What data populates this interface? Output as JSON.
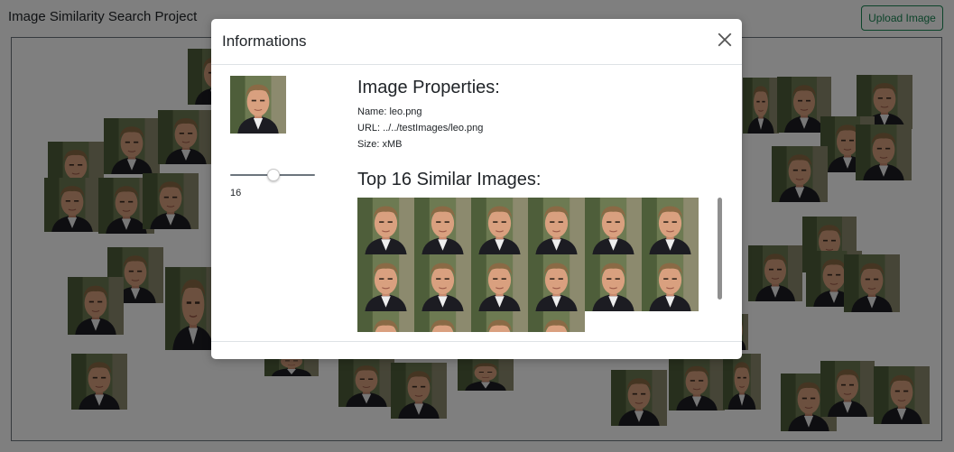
{
  "page": {
    "title": "Image Similarity Search Project",
    "upload_button": "Upload Image",
    "accent_color": "#198754"
  },
  "modal": {
    "title": "Informations",
    "close_icon": "close-icon",
    "slider": {
      "value": 16,
      "value_label": "16",
      "level": 0.5
    },
    "properties": {
      "heading": "Image Properties:",
      "name": "Name: leo.png",
      "url": "URL: ../../testImages/leo.png",
      "size": "Size: xMB"
    },
    "similar": {
      "heading": "Top 16 Similar Images:",
      "count": 16
    }
  }
}
